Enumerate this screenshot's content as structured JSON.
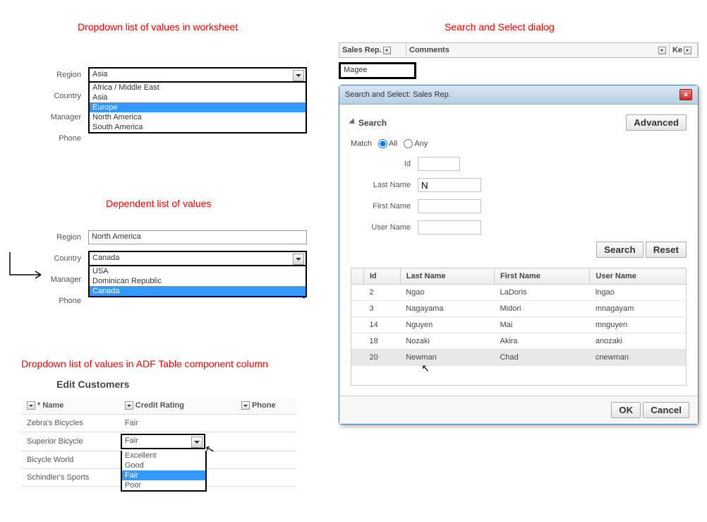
{
  "labels": {
    "title1": "Dropdown list of values in worksheet",
    "title2": "Dependent list of values",
    "title3": "Dropdown list of values in ADF Table component column",
    "title4": "Search and Select dialog"
  },
  "form": {
    "region_label": "Region",
    "country_label": "Country",
    "manager_label": "Manager",
    "phone_label": "Phone"
  },
  "section1": {
    "region_value": "Asia",
    "options": [
      "Africa / Middle East",
      "Asia",
      "Europe",
      "North America",
      "South America"
    ],
    "selected": "Europe"
  },
  "section2": {
    "region_value": "North America",
    "country_value": "Canada",
    "options": [
      "USA",
      "Dominican Republic",
      "Canada"
    ],
    "selected": "Canada"
  },
  "section3": {
    "edit_title": "Edit Customers",
    "cols": {
      "name": "* Name",
      "rating": "Credit Rating",
      "phone": "Phone"
    },
    "rows": [
      {
        "name": "Zebra's Bicycles",
        "rating": "Fair"
      },
      {
        "name": "Superior Bicycle",
        "rating": "Fair"
      },
      {
        "name": "Bicycle World",
        "rating": ""
      },
      {
        "name": "Schindler's Sports",
        "rating": ""
      }
    ],
    "rating_options": [
      "Excellent",
      "Good",
      "Fair",
      "Poor"
    ],
    "rating_selected": "Fair"
  },
  "right": {
    "col_salesrep": "Sales Rep.",
    "col_comments": "Comments",
    "col_ke": "Ke",
    "input_value": "Magee",
    "dialog_title": "Search and Select: Sales Rep.",
    "search_label": "Search",
    "advanced_btn": "Advanced",
    "match_label": "Match",
    "match_all": "All",
    "match_any": "Any",
    "field_id": "Id",
    "field_lastname": "Last Name",
    "field_firstname": "First Name",
    "field_username": "User Name",
    "lastname_value": "N",
    "search_btn": "Search",
    "reset_btn": "Reset",
    "ok_btn": "OK",
    "cancel_btn": "Cancel",
    "results": [
      {
        "id": "2",
        "last": "Ngao",
        "first": "LaDoris",
        "user": "lngao"
      },
      {
        "id": "3",
        "last": "Nagayama",
        "first": "Midori",
        "user": "mnagayam"
      },
      {
        "id": "14",
        "last": "Nguyen",
        "first": "Mai",
        "user": "mnguyen"
      },
      {
        "id": "18",
        "last": "Nozaki",
        "first": "Akira",
        "user": "anozaki"
      },
      {
        "id": "20",
        "last": "Newman",
        "first": "Chad",
        "user": "cnewman"
      }
    ]
  }
}
